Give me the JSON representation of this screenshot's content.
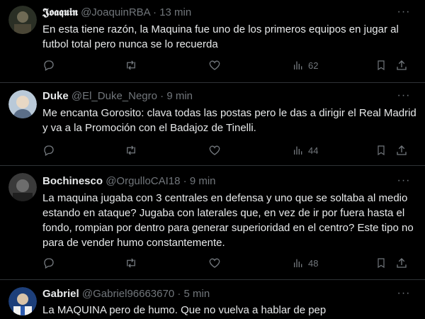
{
  "tweets": [
    {
      "name": "𝕵𝖔𝖆𝖖𝖚𝖎𝖓",
      "handle": "@JoaquinRBA",
      "separator": "·",
      "time": "13 min",
      "text": "En esta tiene razón, la Maquina fue uno de los primeros equipos en jugar al futbol total pero nunca se lo recuerda",
      "views": "62"
    },
    {
      "name": "Duke",
      "handle": "@El_Duke_Negro",
      "separator": "·",
      "time": "9 min",
      "text": "Me encanta Gorosito: clava todas las postas pero le das a dirigir el Real Madrid y va a la Promoción con el Badajoz de Tinelli.",
      "views": "44"
    },
    {
      "name": "Bochinesco",
      "handle": "@OrgulloCAI18",
      "separator": "·",
      "time": "9 min",
      "text": "La maquina jugaba con 3 centrales en defensa y uno que se soltaba al medio estando en ataque? Jugaba con laterales que, en vez de ir por fuera hasta el fondo, rompian por dentro para generar superioridad en el centro? Este tipo no para de vender humo constantemente.",
      "views": "48"
    },
    {
      "name": "Gabriel",
      "handle": "@Gabriel96663670",
      "separator": "·",
      "time": "5 min",
      "text": "La MAQUINA pero de humo. Que no vuelva a hablar de pep"
    }
  ],
  "more_glyph": "···",
  "icons": [
    "reply-icon",
    "retweet-icon",
    "like-icon",
    "views-icon",
    "bookmark-icon",
    "share-icon"
  ]
}
